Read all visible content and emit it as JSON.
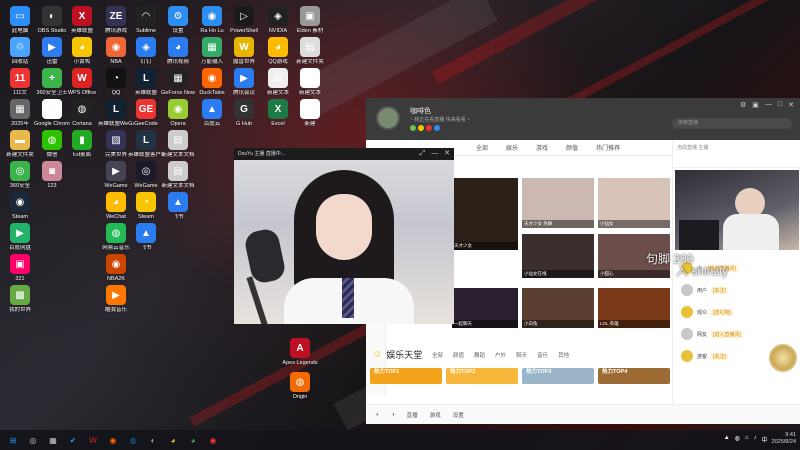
{
  "desktop": {
    "icons_col1": [
      {
        "label": "此电脑",
        "color": "#2c8ef8",
        "glyph": "▭"
      },
      {
        "label": "回收站",
        "color": "#4aa3ff",
        "glyph": "♲"
      },
      {
        "label": "111文",
        "color": "#e33",
        "glyph": "11"
      },
      {
        "label": "2025年",
        "color": "#666",
        "glyph": "▦"
      },
      {
        "label": "新建文件夹",
        "color": "#e8b84a",
        "glyph": "▬"
      },
      {
        "label": "360安全",
        "color": "#3cb44b",
        "glyph": "◎"
      },
      {
        "label": "Steam",
        "color": "#1b2838",
        "glyph": "◉"
      },
      {
        "label": "百度网盘",
        "color": "#24b36b",
        "glyph": "▶"
      },
      {
        "label": "321",
        "color": "#f06",
        "glyph": "▣"
      },
      {
        "label": "我的世界",
        "color": "#6a4",
        "glyph": "▩"
      }
    ],
    "icons_col2": [
      {
        "label": "OBS Studio",
        "color": "#333",
        "glyph": "◐"
      },
      {
        "label": "迅雷",
        "color": "#2d7cf0",
        "glyph": "▶"
      },
      {
        "label": "360安全卫士",
        "color": "#3cb44b",
        "glyph": "+"
      },
      {
        "label": "Google Chrome",
        "color": "#fff",
        "glyph": "◕"
      },
      {
        "label": "微信",
        "color": "#2dc100",
        "glyph": "◍"
      },
      {
        "label": "123",
        "color": "#c89",
        "glyph": "◙"
      }
    ],
    "icons_col3": [
      {
        "label": "英雄联盟",
        "color": "#b12",
        "glyph": "X"
      },
      {
        "label": "小黄鸭",
        "color": "#f7c600",
        "glyph": "◕"
      },
      {
        "label": "WPS Office",
        "color": "#d22",
        "glyph": "W"
      },
      {
        "label": "Cortana",
        "color": "#222",
        "glyph": "◍"
      },
      {
        "label": "lcd桌面",
        "color": "#2a2",
        "glyph": "▮"
      }
    ],
    "icons_col4": [
      {
        "label": "腾讯游戏",
        "color": "#335",
        "glyph": "ZE"
      },
      {
        "label": "NBA",
        "color": "#e63",
        "glyph": "◉"
      },
      {
        "label": "QQ",
        "color": "#111",
        "glyph": "◔"
      },
      {
        "label": "英雄联盟WeGame",
        "color": "#123",
        "glyph": "L"
      },
      {
        "label": "完美世界",
        "color": "#335",
        "glyph": "▧"
      },
      {
        "label": "WeGame",
        "color": "#445",
        "glyph": "▶"
      },
      {
        "label": "WeChat",
        "color": "#fb0",
        "glyph": "◕"
      },
      {
        "label": "网易云音乐",
        "color": "#2b5",
        "glyph": "◍"
      },
      {
        "label": "NBA2K",
        "color": "#c40",
        "glyph": "◉"
      },
      {
        "label": "酷我音乐",
        "color": "#f70",
        "glyph": "▶"
      }
    ],
    "icons_col5": [
      {
        "label": "Sublime",
        "color": "#222",
        "glyph": "◠"
      },
      {
        "label": "钉钉",
        "color": "#2b7cf0",
        "glyph": "◈"
      },
      {
        "label": "英雄联盟",
        "color": "#123",
        "glyph": "L"
      },
      {
        "label": "GeeCode",
        "color": "#e33",
        "glyph": "GE"
      },
      {
        "label": "英雄联盟客户端",
        "color": "#234",
        "glyph": "L"
      },
      {
        "label": "WeGame",
        "color": "#1a1a2a",
        "glyph": "◎"
      },
      {
        "label": "Steam",
        "color": "#f8c600",
        "glyph": "◔"
      },
      {
        "label": "飞书",
        "color": "#2b7cf0",
        "glyph": "▲"
      }
    ],
    "icons_col6": [
      {
        "label": "设置",
        "color": "#2b8ef0",
        "glyph": "⚙"
      },
      {
        "label": "腾讯视频",
        "color": "#2b7cf0",
        "glyph": "◕"
      },
      {
        "label": "GeForce Now",
        "color": "#222",
        "glyph": "▦"
      },
      {
        "label": "Opera",
        "color": "#9c3",
        "glyph": "◉"
      },
      {
        "label": "新建文本文档",
        "color": "#ccc",
        "glyph": "▤"
      },
      {
        "label": "新建文本文档",
        "color": "#ccc",
        "glyph": "▤"
      },
      {
        "label": "飞书",
        "color": "#2b7cf0",
        "glyph": "▲"
      }
    ],
    "icons_col7": [
      {
        "label": "Ra Ho Lu",
        "color": "#2b8ef0",
        "glyph": "◉"
      },
      {
        "label": "万能输入",
        "color": "#3a6",
        "glyph": "▦"
      },
      {
        "label": "DuckTales",
        "color": "#f60",
        "glyph": "◉"
      },
      {
        "label": "百度云",
        "color": "#2b7cf0",
        "glyph": "▲"
      }
    ],
    "icons_col8": [
      {
        "label": "PowerShell",
        "color": "#1a1a1a",
        "glyph": "▷"
      },
      {
        "label": "魔兽世界",
        "color": "#e7b400",
        "glyph": "W"
      },
      {
        "label": "腾讯会议",
        "color": "#2b7cf0",
        "glyph": "▶"
      },
      {
        "label": "G Hub",
        "color": "#333",
        "glyph": "G"
      }
    ],
    "icons_col9": [
      {
        "label": "NVIDIA",
        "color": "#222",
        "glyph": "◈"
      },
      {
        "label": "QQ游戏",
        "color": "#fb0",
        "glyph": "◕"
      },
      {
        "label": "新建文本",
        "color": "#eee",
        "glyph": "▤"
      },
      {
        "label": "Excel",
        "color": "#1d7a44",
        "glyph": "X"
      }
    ],
    "icons_col10": [
      {
        "label": "Elden 素材",
        "color": "#999",
        "glyph": "▣"
      },
      {
        "label": "新建文件夹",
        "color": "#ddd",
        "glyph": "▤"
      },
      {
        "label": "新建文本",
        "color": "#fff",
        "glyph": "▤"
      },
      {
        "label": "新建",
        "color": "#fff",
        "glyph": "▥"
      }
    ],
    "icons_col4_extra": [
      {
        "label": "Apex Legends",
        "color": "#b12",
        "glyph": "A"
      },
      {
        "label": "Origin",
        "color": "#f56a00",
        "glyph": "◍"
      }
    ]
  },
  "video_window": {
    "title": "DouYu 主播 直播中...",
    "controls": [
      "⤢",
      "—",
      "✕"
    ]
  },
  "app": {
    "user_name": "咖啡色",
    "user_sub": "~ 我正在看直播 快来看看 ~",
    "search_placeholder": "搜索直播",
    "window_controls": [
      "⚙",
      "▣",
      "—",
      "□",
      "✕"
    ],
    "nav": [
      "全部",
      "娱乐",
      "游戏",
      "颜值",
      "热门推荐"
    ],
    "grid": [
      {
        "caption": "天才少女",
        "bg": "#2a2018"
      },
      {
        "caption": "天才少女 热舞",
        "bg": "#cbb8b0"
      },
      {
        "caption": "小仙女",
        "bg": "#d8c3b8"
      },
      {
        "caption": "小仙女在线",
        "bg": "#3a2e2e"
      },
      {
        "caption": "小甜心",
        "bg": "#6b4e4a"
      },
      {
        "caption": "一起聊天",
        "bg": "#2b2030"
      },
      {
        "caption": "小白兔",
        "bg": "#5a3e30"
      },
      {
        "caption": "LOL 英雄",
        "bg": "#7a3a1a"
      }
    ],
    "section_title": "娱乐天堂",
    "section_tabs": [
      "全部",
      "颜值",
      "舞蹈",
      "户外",
      "聊天",
      "音乐",
      "其他"
    ],
    "top_cards": [
      {
        "label": "热力TOP1",
        "color": "#f3a21b"
      },
      {
        "label": "热力TOP2",
        "color": "#f6b63a"
      },
      {
        "label": "热力TOP3",
        "color": "#9ab4c8"
      },
      {
        "label": "热力TOP4",
        "color": "#9c6b34"
      }
    ],
    "bottom_items": [
      "◐",
      "◑",
      "直播",
      "游戏",
      "设置"
    ],
    "live_head": "当前直播 主播",
    "overlay_text": "句脚 200",
    "overlay_text2": "入 shinzly",
    "chats": [
      {
        "name": "小",
        "tag": "[新进直播间]"
      },
      {
        "name": "用户",
        "tag": "[关注]"
      },
      {
        "name": "观众",
        "tag": "[送礼物]"
      },
      {
        "name": "网友",
        "tag": "[进入直播间]"
      },
      {
        "name": "游客",
        "tag": "[关注]"
      }
    ]
  },
  "taskbar": {
    "buttons": [
      {
        "glyph": "⊞",
        "color": "#2b8ef0"
      },
      {
        "glyph": "◎",
        "color": "#ccc"
      },
      {
        "glyph": "▦",
        "color": "#ccc"
      },
      {
        "glyph": "✔",
        "color": "#2b8ef0"
      },
      {
        "glyph": "W",
        "color": "#d22"
      },
      {
        "glyph": "◉",
        "color": "#f60"
      },
      {
        "glyph": "◍",
        "color": "#1b6a9c"
      },
      {
        "glyph": "◐",
        "color": "#aaa"
      },
      {
        "glyph": "◕",
        "color": "#f7c600"
      },
      {
        "glyph": "◕",
        "color": "#3cb44b"
      },
      {
        "glyph": "◉",
        "color": "#e33"
      }
    ],
    "tray_icons": [
      "▲",
      "◍",
      "⌂",
      "♪",
      "中"
    ],
    "time": "9:41",
    "date": "2025/8/24"
  }
}
